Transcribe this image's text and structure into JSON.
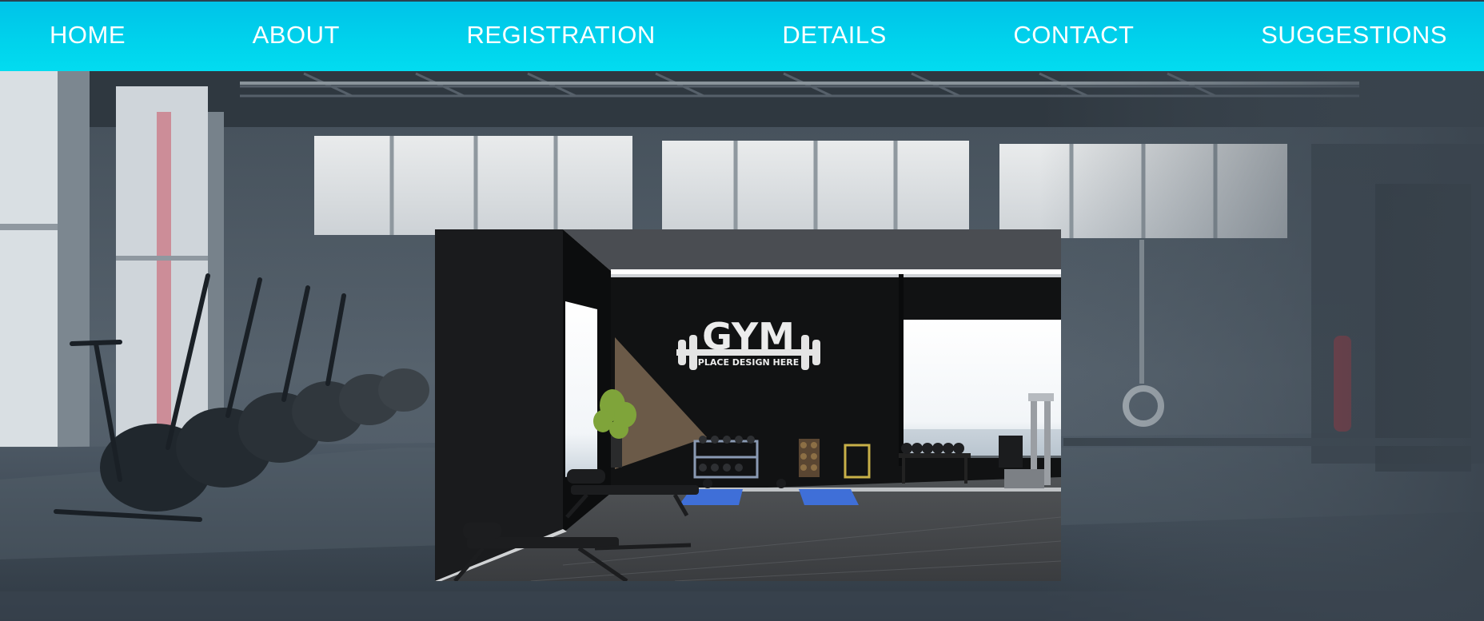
{
  "nav": {
    "items": [
      {
        "label": "HOME"
      },
      {
        "label": "ABOUT"
      },
      {
        "label": "REGISTRATION"
      },
      {
        "label": "DETAILS"
      },
      {
        "label": "CONTACT"
      },
      {
        "label": "SUGGESTIONS"
      }
    ]
  },
  "hero": {
    "logo_text": "GYM",
    "logo_subtext": "PLACE DESIGN HERE"
  },
  "colors": {
    "nav_background": "#00c8ea",
    "nav_text": "#ffffff"
  },
  "icons": [
    "barbell-logo"
  ]
}
